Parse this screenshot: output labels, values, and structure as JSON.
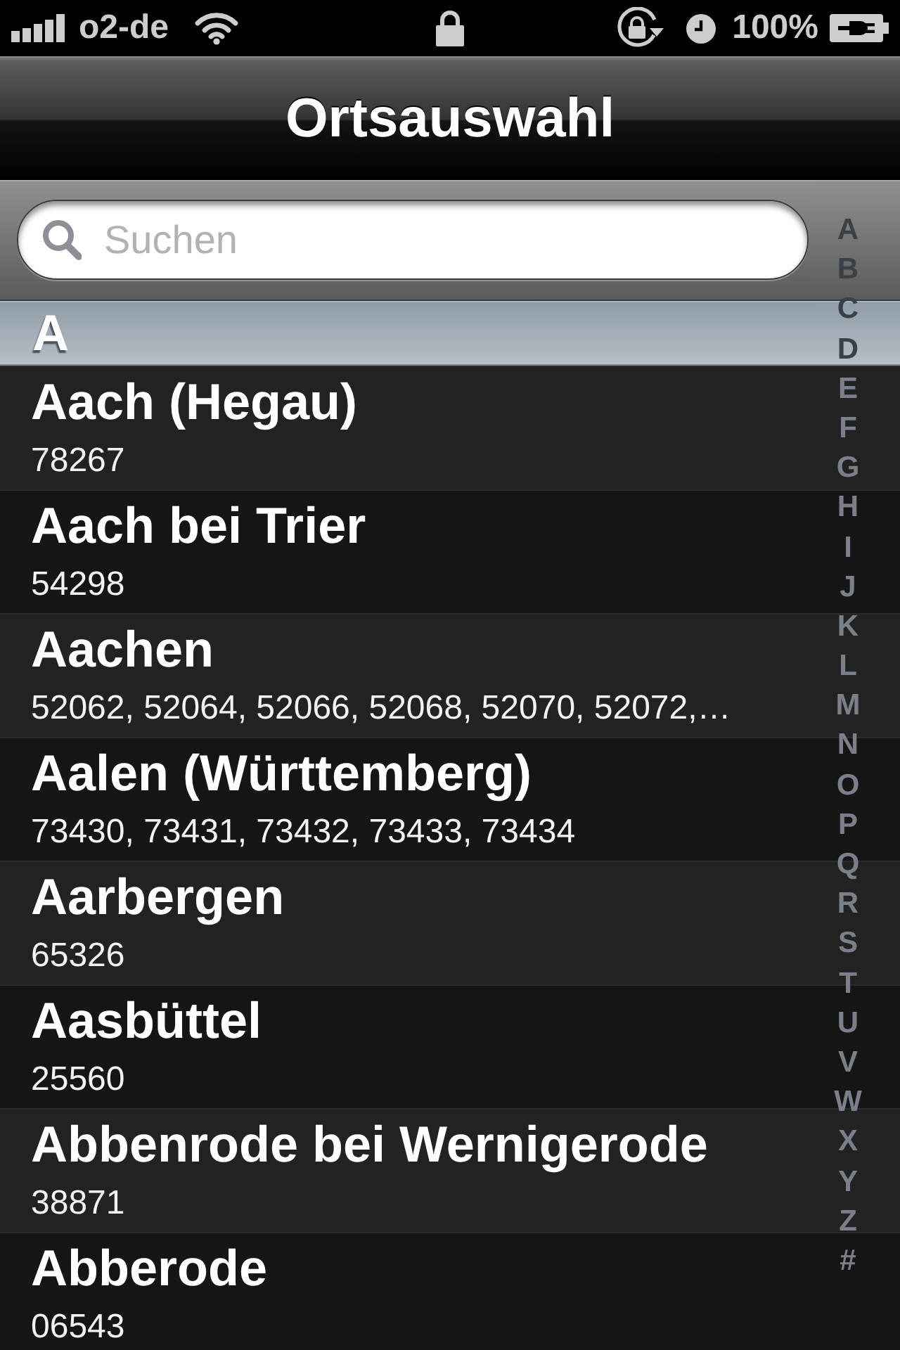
{
  "status_bar": {
    "carrier": "o2-de",
    "battery": "100%"
  },
  "nav_bar": {
    "title": "Ortsauswahl"
  },
  "search": {
    "placeholder": "Suchen"
  },
  "sections": [
    {
      "header": "A",
      "rows": [
        {
          "name": "Aach (Hegau)",
          "postcodes": "78267"
        },
        {
          "name": "Aach bei Trier",
          "postcodes": "54298"
        },
        {
          "name": "Aachen",
          "postcodes": "52062, 52064, 52066, 52068, 52070, 52072,…"
        },
        {
          "name": "Aalen (Württemberg)",
          "postcodes": "73430, 73431, 73432, 73433, 73434"
        },
        {
          "name": "Aarbergen",
          "postcodes": "65326"
        },
        {
          "name": "Aasbüttel",
          "postcodes": "25560"
        },
        {
          "name": "Abbenrode bei Wernigerode",
          "postcodes": "38871"
        },
        {
          "name": "Abberode",
          "postcodes": "06543"
        }
      ]
    }
  ],
  "index": [
    "A",
    "B",
    "C",
    "D",
    "E",
    "F",
    "G",
    "H",
    "I",
    "J",
    "K",
    "L",
    "M",
    "N",
    "O",
    "P",
    "Q",
    "R",
    "S",
    "T",
    "U",
    "V",
    "W",
    "X",
    "Y",
    "Z",
    "#"
  ]
}
